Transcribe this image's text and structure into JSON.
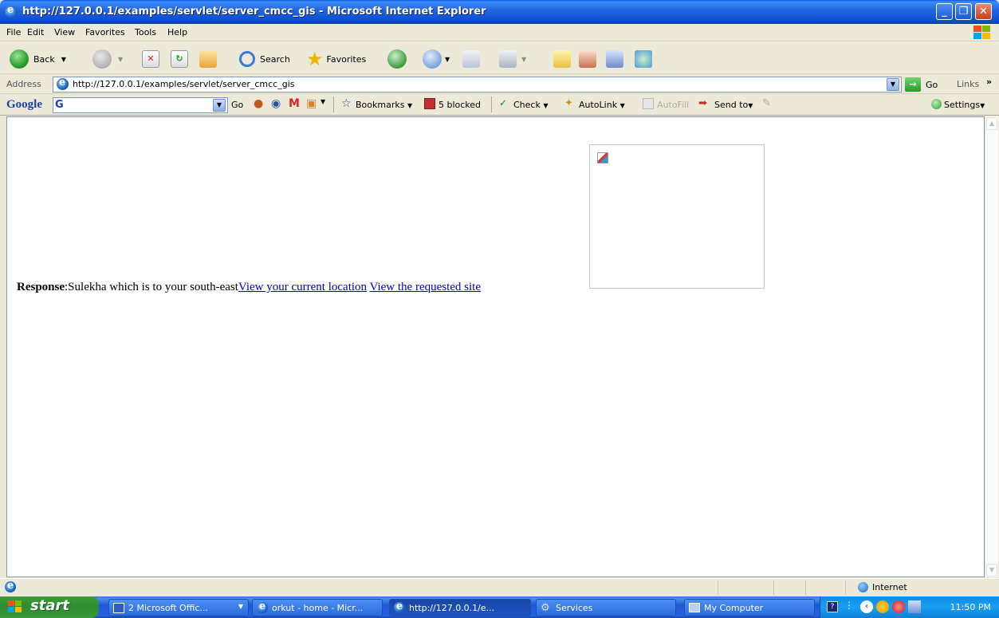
{
  "window": {
    "title": "http://127.0.0.1/examples/servlet/server_cmcc_gis - Microsoft Internet Explorer"
  },
  "menubar": {
    "items": [
      "File",
      "Edit",
      "View",
      "Favorites",
      "Tools",
      "Help"
    ]
  },
  "toolbar": {
    "back_label": "Back",
    "search_label": "Search",
    "favorites_label": "Favorites"
  },
  "address": {
    "label": "Address",
    "value": "http://127.0.0.1/examples/servlet/server_cmcc_gis",
    "go_label": "Go",
    "links_label": "Links"
  },
  "googlebar": {
    "logo": "Google",
    "go_label": "Go",
    "bookmarks_label": "Bookmarks",
    "blocked_label": "5 blocked",
    "check_label": "Check",
    "autolink_label": "AutoLink",
    "autofill_label": "AutoFill",
    "sendto_label": "Send to",
    "settings_label": "Settings"
  },
  "content": {
    "response_label": "Response",
    "response_text": ":Sulekha which is to your south-east",
    "link_current": "View your current location",
    "link_requested": "View the requested site"
  },
  "statusbar": {
    "zone": "Internet"
  },
  "taskbar": {
    "start_label": "start",
    "tasks": [
      "2 Microsoft Offic...",
      "orkut - home - Micr...",
      "http://127.0.0.1/e...",
      "Services",
      "My Computer"
    ],
    "clock": "11:50 PM"
  },
  "colors": {
    "titlebar": "#0a4ecf",
    "link": "#0000cc",
    "chrome": "#ece9d8"
  }
}
